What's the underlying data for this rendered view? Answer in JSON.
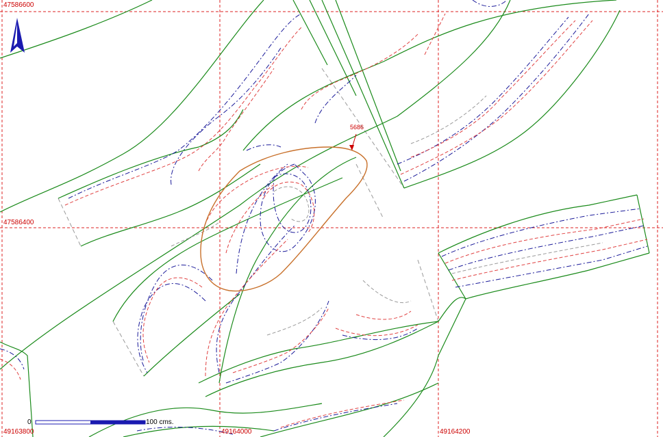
{
  "grid": {
    "y_labels": [
      "47586600",
      "47586400"
    ],
    "x_labels": [
      "49163800",
      "49164000",
      "49164200"
    ]
  },
  "point_label": "5686",
  "scale_bar": {
    "start": "0",
    "end": "100",
    "unit": "cms."
  },
  "icons": {
    "north_arrow": "north-arrow-icon"
  },
  "colors": {
    "grid": "#dd2222",
    "boundary": "#1a8a1a",
    "contour_blue": "#1a1a99",
    "contour_red": "#e04040",
    "contour_gray": "#9a9a9a",
    "highlight": "#c8702a",
    "north": "#1a1ab0"
  }
}
